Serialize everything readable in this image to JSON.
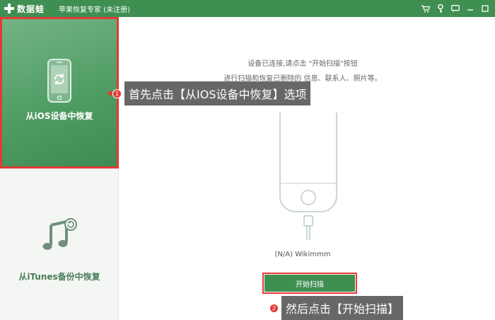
{
  "titlebar": {
    "brand": "数据蛙",
    "title": "苹果恢复专家 (未注册)",
    "icons": [
      "cart-icon",
      "key-icon",
      "chat-icon",
      "minimize-icon",
      "close-icon"
    ]
  },
  "sidebar": {
    "items": [
      {
        "label": "从iOS设备中恢复",
        "icon": "phone-refresh-icon",
        "active": true
      },
      {
        "label": "从iTunes备份中恢复",
        "icon": "music-refresh-icon",
        "active": false
      }
    ]
  },
  "main": {
    "instruction_line1": "设备已连接,请点击 \"开始扫描\"按钮",
    "instruction_line2": "进行扫描和恢复已删除的 信息、联系人、照片等。",
    "device_name": "(N/A) Wikimmm",
    "scan_button": "开始扫描"
  },
  "callouts": [
    {
      "number": "1",
      "text": "首先点击【从IOS设备中恢复】选项"
    },
    {
      "number": "2",
      "text": "然后点击【开始扫描】"
    }
  ],
  "colors": {
    "brand_green": "#3f8f52",
    "highlight_red": "#e53935"
  }
}
